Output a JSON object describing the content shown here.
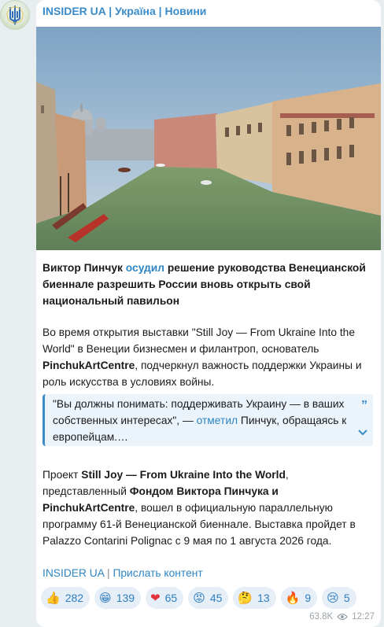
{
  "channel": {
    "name": "INSIDER UA | Україна | Новини"
  },
  "post": {
    "headline_a": "Виктор Пинчук ",
    "headline_link": "осудил",
    "headline_b": " решение руководства Венецианской биеннале разрешить России вновь открыть свой национальный павильон",
    "p1_a": "Во время открытия выставки \"Still Joy — From Ukraine Into the World\" в Венеции бизнесмен и филантроп, основатель ",
    "p1_bold": "PinchukArtCentre",
    "p1_b": ", подчеркнул важность поддержки Украины и роль искусства в условиях войны.",
    "quote_a": "\"Вы должны понимать: поддерживать Украину — в ваших собственных интересах\", — ",
    "quote_link": "отметил",
    "quote_b": " Пинчук, обращаясь к европейцам.…",
    "p2_a": "Проект ",
    "p2_bold1": "Still Joy — From Ukraine Into the World",
    "p2_b": ", представленный ",
    "p2_bold2": "Фондом Виктора Пинчука и PinchukArtCentre",
    "p2_c": ", вошел в официальную параллельную программу 61-й Венецианской биеннале. Выставка пройдет в Palazzo Contarini Polignac с 9 мая по 1 августа 2026 года."
  },
  "footer": {
    "link1": "INSIDER UA",
    "sep": " | ",
    "link2": "Прислать контент"
  },
  "reactions": [
    {
      "emoji": "👍",
      "count": "282"
    },
    {
      "emoji": "😁",
      "count": "139"
    },
    {
      "emoji": "❤",
      "count": "65"
    },
    {
      "emoji": "😡",
      "count": "45"
    },
    {
      "emoji": "🤔",
      "count": "13"
    },
    {
      "emoji": "🔥",
      "count": "9"
    },
    {
      "emoji": "😢",
      "count": "5"
    }
  ],
  "meta": {
    "views": "63.8K",
    "time": "12:27"
  },
  "colors": {
    "accent": "#3a8bc9",
    "bubble": "#ffffff",
    "background": "#e8eef0",
    "reaction_bg": "#e6eef7"
  },
  "icons": {
    "avatar": "trident-logo-icon",
    "quote": "quote-icon",
    "expand": "chevron-down-icon",
    "views": "eye-icon"
  }
}
